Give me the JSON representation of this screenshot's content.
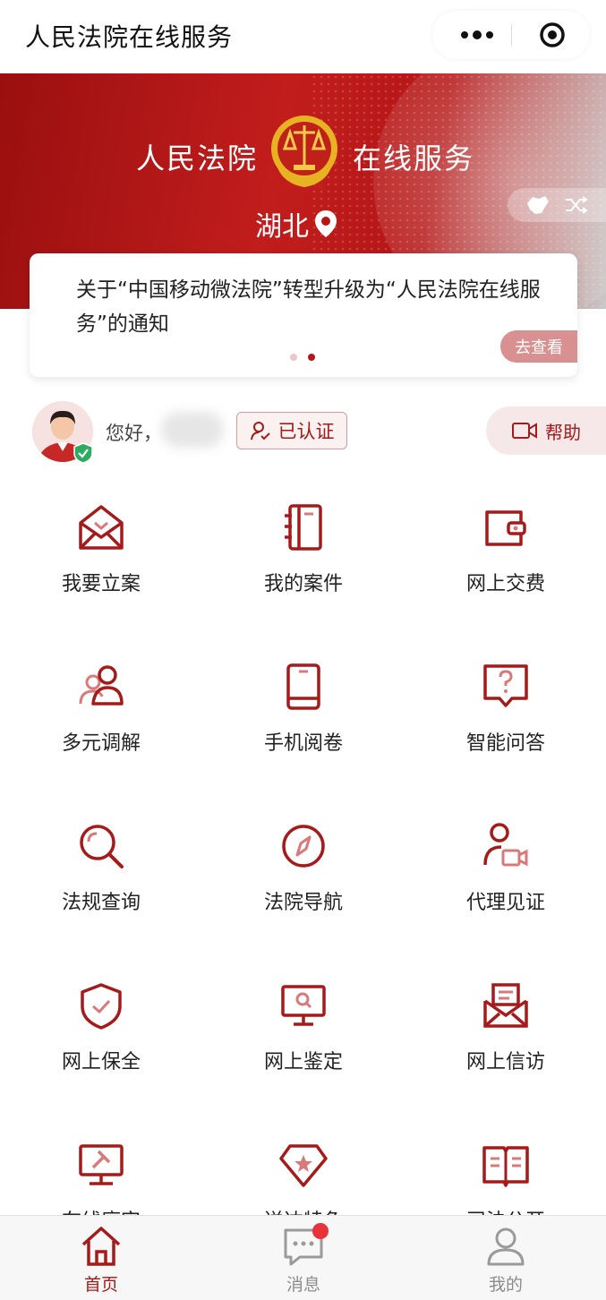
{
  "nav": {
    "title": "人民法院在线服务"
  },
  "banner": {
    "left_text": "人民法院",
    "right_text": "在线服务",
    "region": "湖北"
  },
  "notice": {
    "text": "关于“中国移动微法院”转型升级为“人民法院在线服务”的通知",
    "button": "去查看",
    "pages": 2,
    "active_page": 2
  },
  "user": {
    "greeting": "您好，",
    "verified_label": "已认证",
    "help_label": "帮助"
  },
  "services": [
    {
      "label": "我要立案",
      "icon": "envelope-icon"
    },
    {
      "label": "我的案件",
      "icon": "notebook-icon"
    },
    {
      "label": "网上交费",
      "icon": "wallet-icon"
    },
    {
      "label": "多元调解",
      "icon": "people-icon"
    },
    {
      "label": "手机阅卷",
      "icon": "tablet-icon"
    },
    {
      "label": "智能问答",
      "icon": "question-bubble-icon"
    },
    {
      "label": "法规查询",
      "icon": "magnifier-icon"
    },
    {
      "label": "法院导航",
      "icon": "compass-icon"
    },
    {
      "label": "代理见证",
      "icon": "person-video-icon"
    },
    {
      "label": "网上保全",
      "icon": "shield-check-icon"
    },
    {
      "label": "网上鉴定",
      "icon": "monitor-search-icon"
    },
    {
      "label": "网上信访",
      "icon": "letter-icon"
    },
    {
      "label": "在线庭审",
      "icon": "gavel-monitor-icon"
    },
    {
      "label": "送达特色",
      "icon": "star-badge-icon"
    },
    {
      "label": "司法公开",
      "icon": "open-book-icon"
    }
  ],
  "tabs": [
    {
      "label": "首页",
      "icon": "home-icon",
      "active": true
    },
    {
      "label": "消息",
      "icon": "message-icon",
      "active": false
    },
    {
      "label": "我的",
      "icon": "profile-icon",
      "active": false
    }
  ],
  "colors": {
    "brand": "#a51a1a",
    "banner": "#b51616",
    "badge": "#e8333a"
  }
}
